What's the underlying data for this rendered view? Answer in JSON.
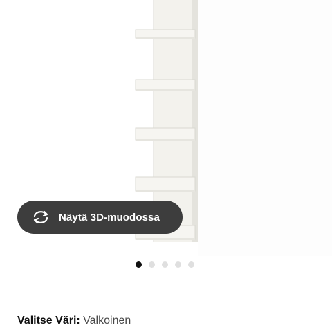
{
  "product_image": {
    "image_name": "wall-shelf-unit-image",
    "color_value_hex": "#f2f1ec"
  },
  "view_3d_button": {
    "label": "Näytä 3D-muodossa",
    "icon": "rotate-arrows-icon"
  },
  "gallery_pager": {
    "count": 5,
    "active_index": 0
  },
  "color_choice": {
    "label": "Valitse Väri:",
    "value": "Valkoinen"
  },
  "colors": {
    "button_bg": "#3d3d3d",
    "dot_active": "#111111",
    "dot_inactive": "#dfdfdf"
  }
}
